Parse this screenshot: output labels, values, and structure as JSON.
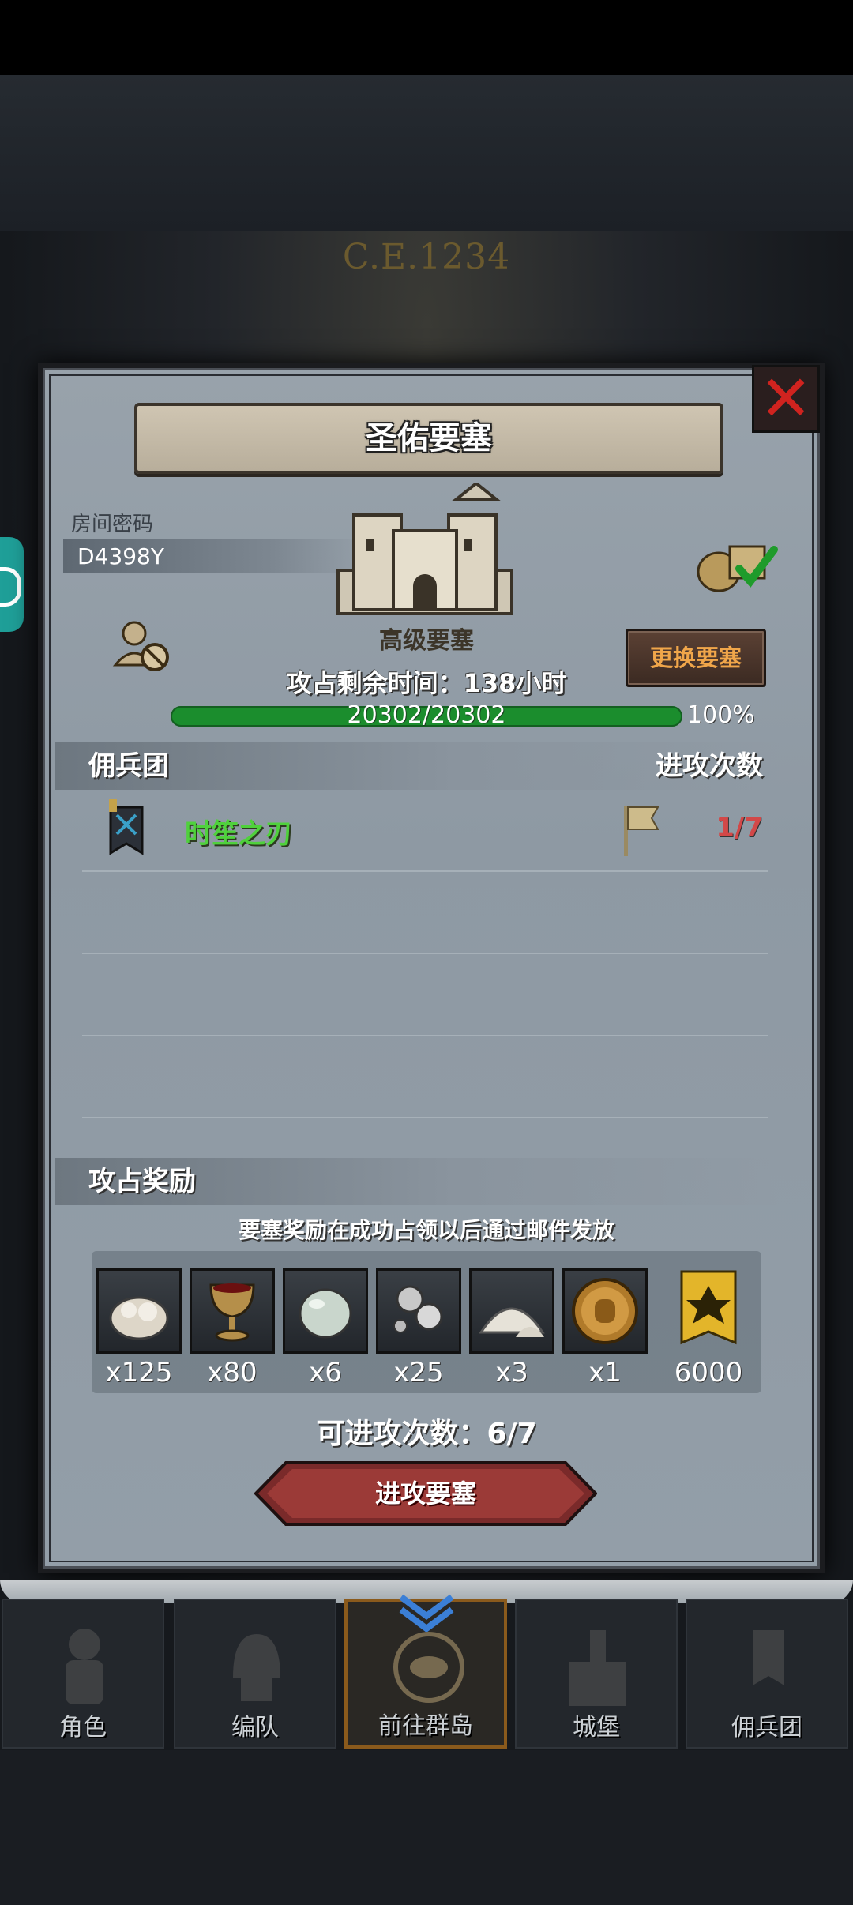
{
  "header": {
    "era": "C.E.1234"
  },
  "dialog": {
    "title": "圣佑要塞",
    "room_label": "房间密码",
    "room_code": "D4398Y",
    "fort_type": "高级要塞",
    "time_left": "攻占剩余时间：138小时",
    "swap_label": "更换要塞",
    "hp_text": "20302/20302",
    "hp_percent": "100%",
    "hp_fraction": 1.0,
    "mercenary_header": "佣兵团",
    "attack_header": "进攻次数",
    "mercenaries": [
      {
        "name": "时笙之刃",
        "attacks": "1/7"
      }
    ],
    "reward_header": "攻占奖励",
    "reward_note": "要塞奖励在成功占领以后通过邮件发放",
    "rewards": [
      {
        "icon": "ore-pile-icon",
        "qty": "x125"
      },
      {
        "icon": "goblet-icon",
        "qty": "x80"
      },
      {
        "icon": "gem-stone-icon",
        "qty": "x6"
      },
      {
        "icon": "silver-orbs-icon",
        "qty": "x25"
      },
      {
        "icon": "salt-pile-icon",
        "qty": "x3"
      },
      {
        "icon": "knight-medal-icon",
        "qty": "x1"
      },
      {
        "icon": "guild-banner-icon",
        "qty": "6000"
      }
    ],
    "attacks_left": "可进攻次数：6/7",
    "attack_button": "进攻要塞"
  },
  "nav": {
    "items": [
      {
        "label": "角色",
        "icon": "knight-icon"
      },
      {
        "label": "编队",
        "icon": "helmet-icon"
      },
      {
        "label": "前往群岛",
        "icon": "compass-map-icon"
      },
      {
        "label": "城堡",
        "icon": "castle-icon"
      },
      {
        "label": "佣兵团",
        "icon": "mercenary-icon"
      }
    ]
  },
  "colors": {
    "accent": "#f0a64a",
    "hp": "#1b8d2d",
    "guild_name": "#4fd13c",
    "close": "#d0231f"
  }
}
